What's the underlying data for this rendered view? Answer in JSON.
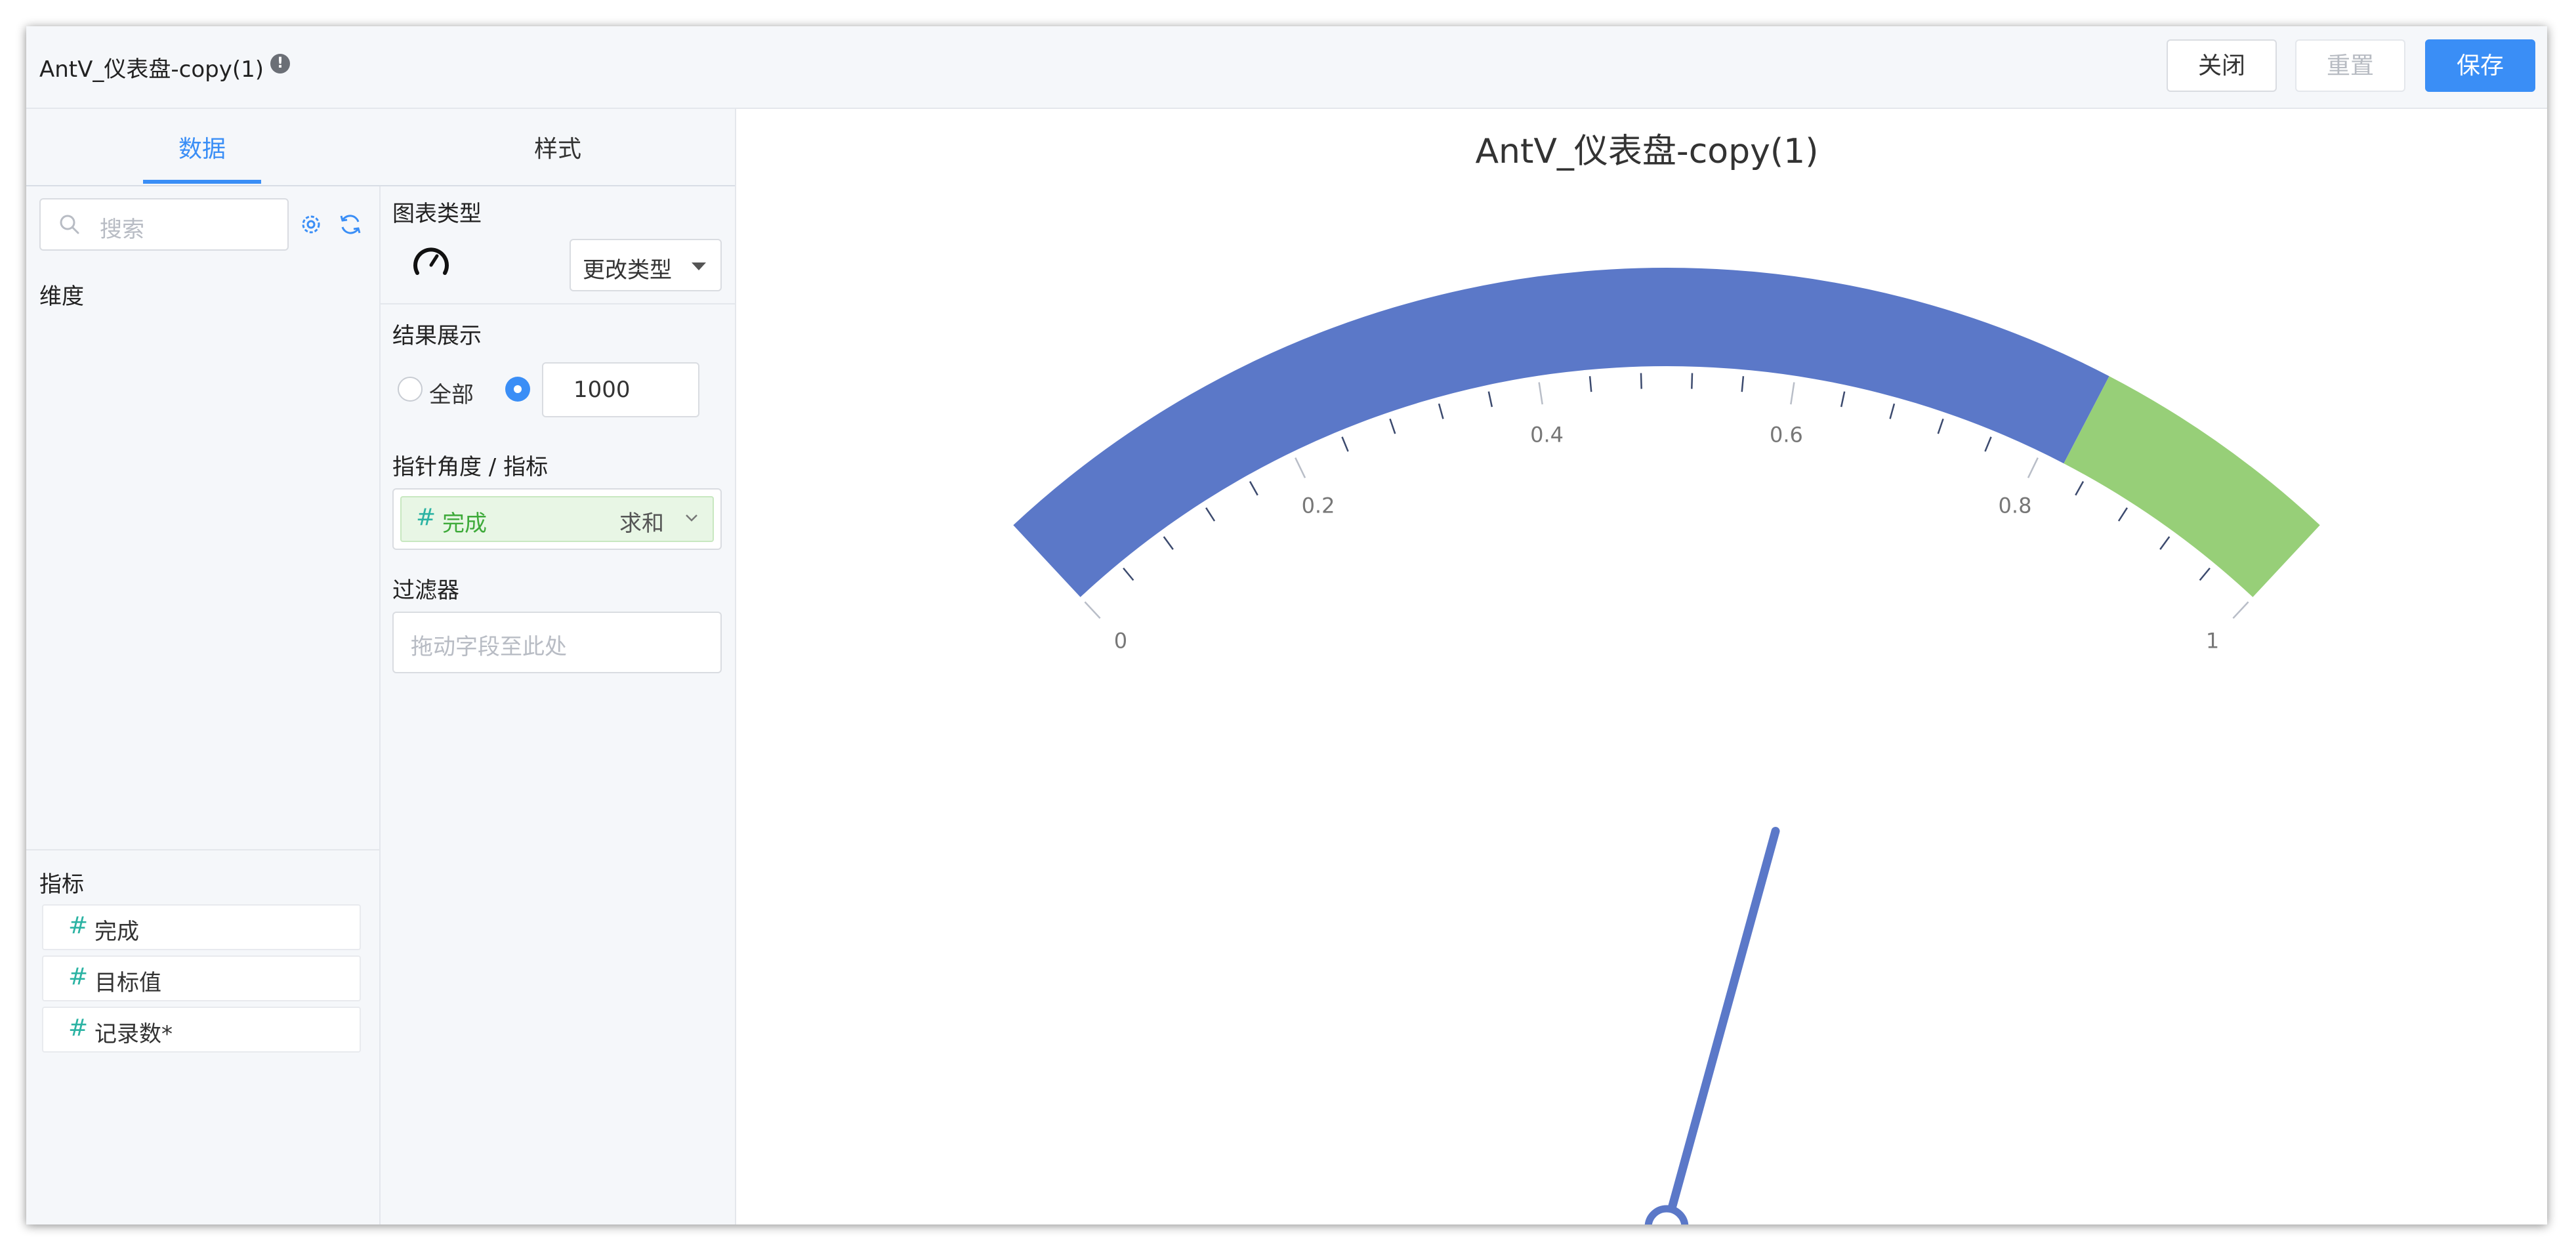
{
  "header": {
    "title": "AntV_仪表盘-copy(1)",
    "info_icon": "info-icon",
    "close_label": "关闭",
    "reset_label": "重置",
    "save_label": "保存"
  },
  "tabs": {
    "data_label": "数据",
    "style_label": "样式"
  },
  "fields": {
    "search_placeholder": "搜索",
    "dimensions_label": "维度",
    "measures_label": "指标",
    "measures": [
      {
        "label": "完成"
      },
      {
        "label": "目标值"
      },
      {
        "label": "记录数*"
      }
    ]
  },
  "config": {
    "chart_type_label": "图表类型",
    "change_type_label": "更改类型",
    "result_label": "结果展示",
    "result_all_label": "全部",
    "result_limit_value": "1000",
    "pointer_label": "指针角度 / 指标",
    "pointer_field": "完成",
    "pointer_agg": "求和",
    "filter_label": "过滤器",
    "filter_placeholder": "拖动字段至此处"
  },
  "colors": {
    "accent": "#3a8ef6",
    "gauge_main": "#5b78c8",
    "gauge_end": "#97cf78"
  },
  "chart_data": {
    "type": "gauge",
    "title": "AntV_仪表盘-copy(1)",
    "min": 0,
    "max": 1,
    "value": 0.68,
    "ticks": [
      {
        "value": 0,
        "label": "0"
      },
      {
        "value": 0.2,
        "label": "0.2"
      },
      {
        "value": 0.4,
        "label": "0.4"
      },
      {
        "value": 0.6,
        "label": "0.6"
      },
      {
        "value": 0.8,
        "label": "0.8"
      },
      {
        "value": 1,
        "label": "1"
      }
    ],
    "bands": [
      {
        "from": 0,
        "to": 0.82,
        "color": "#5b78c8"
      },
      {
        "from": 0.82,
        "to": 1,
        "color": "#97cf78"
      }
    ]
  }
}
